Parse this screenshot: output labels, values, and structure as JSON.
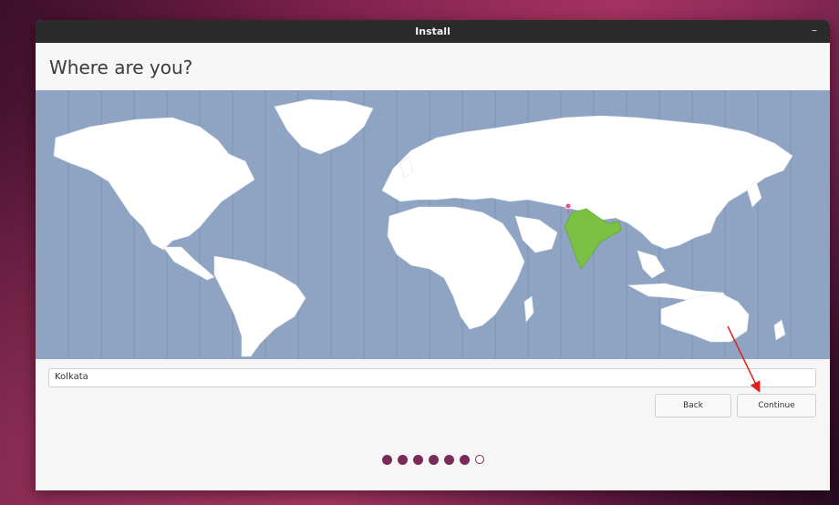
{
  "window": {
    "title": "Install",
    "minimize_icon": "minimize-icon"
  },
  "page": {
    "heading": "Where are you?"
  },
  "location": {
    "value": "Kolkata"
  },
  "buttons": {
    "back": "Back",
    "continue": "Continue"
  },
  "progress": {
    "total_steps": 7,
    "current_step": 6
  },
  "colors": {
    "ocean": "#8fa3c2",
    "land": "#ffffff",
    "selected_region": "#7ac043",
    "accent": "#7a2b5a",
    "annotation_arrow": "#e02020",
    "titlebar": "#2b2b2b"
  }
}
